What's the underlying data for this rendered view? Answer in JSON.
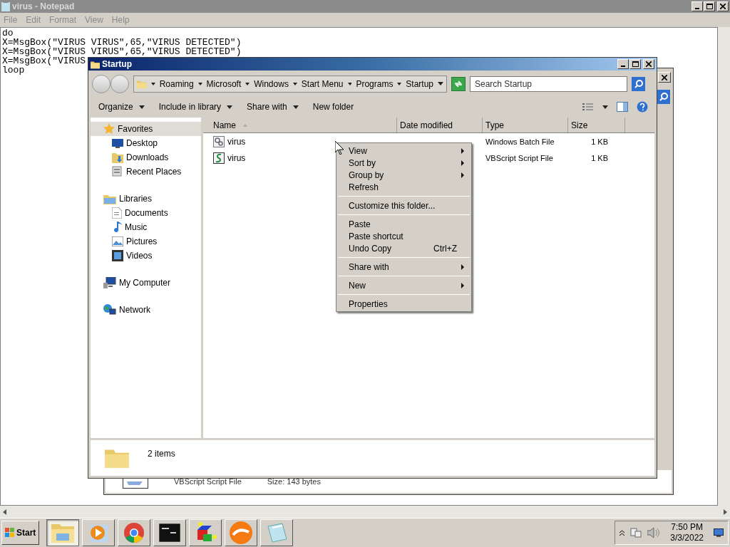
{
  "notepad": {
    "title": "virus - Notepad",
    "menu": [
      "File",
      "Edit",
      "Format",
      "View",
      "Help"
    ],
    "lines": [
      "do",
      "X=MsgBox(\"VIRUS VIRUS\",65,\"VIRUS DETECTED\")",
      "X=MsgBox(\"VIRUS VIRUS\",65,\"VIRUS DETECTED\")",
      "X=MsgBox(\"VIRUS",
      "loop"
    ]
  },
  "back_window": {
    "details": [
      "VBScript Script File",
      "Size: 143 bytes"
    ]
  },
  "explorer": {
    "title": "Startup",
    "breadcrumb": [
      "Roaming",
      "Microsoft",
      "Windows",
      "Start Menu",
      "Programs",
      "Startup"
    ],
    "search": {
      "placeholder": "Search Startup"
    },
    "toolbar": [
      {
        "label": "Organize",
        "dropdown": true
      },
      {
        "label": "Include in library",
        "dropdown": true
      },
      {
        "label": "Share with",
        "dropdown": true
      },
      {
        "label": "New folder",
        "dropdown": false
      }
    ],
    "nav": [
      {
        "label": "Favorites",
        "selected": true,
        "children": [
          {
            "label": "Desktop"
          },
          {
            "label": "Downloads"
          },
          {
            "label": "Recent Places"
          }
        ]
      },
      {
        "label": "Libraries",
        "selected": false,
        "children": [
          {
            "label": "Documents"
          },
          {
            "label": "Music"
          },
          {
            "label": "Pictures"
          },
          {
            "label": "Videos"
          }
        ]
      },
      {
        "label": "My Computer",
        "selected": false
      },
      {
        "label": "Network",
        "selected": false
      }
    ],
    "columns": [
      "Name",
      "Date modified",
      "Type",
      "Size"
    ],
    "files": [
      {
        "name": "virus",
        "kind": "batch",
        "type": "Windows Batch File",
        "size": "1 KB"
      },
      {
        "name": "virus",
        "kind": "script",
        "type": "VBScript Script File",
        "size": "1 KB"
      }
    ],
    "status": "2 items"
  },
  "context_menu": [
    {
      "kind": "item",
      "label": "View",
      "submenu": true
    },
    {
      "kind": "item",
      "label": "Sort by",
      "submenu": true
    },
    {
      "kind": "item",
      "label": "Group by",
      "submenu": true
    },
    {
      "kind": "item",
      "label": "Refresh",
      "submenu": false
    },
    {
      "kind": "separator"
    },
    {
      "kind": "item",
      "label": "Customize this folder...",
      "submenu": false
    },
    {
      "kind": "separator"
    },
    {
      "kind": "item",
      "label": "Paste",
      "submenu": false
    },
    {
      "kind": "item",
      "label": "Paste shortcut",
      "submenu": false
    },
    {
      "kind": "item",
      "label": "Undo Copy",
      "shortcut": "Ctrl+Z",
      "submenu": false
    },
    {
      "kind": "separator"
    },
    {
      "kind": "item",
      "label": "Share with",
      "submenu": true
    },
    {
      "kind": "separator"
    },
    {
      "kind": "item",
      "label": "New",
      "submenu": true
    },
    {
      "kind": "separator"
    },
    {
      "kind": "item",
      "label": "Properties",
      "submenu": false
    }
  ],
  "taskbar": {
    "start": "Start",
    "apps": [
      {
        "kind": "explorer",
        "selected": true
      },
      {
        "kind": "media",
        "selected": false
      },
      {
        "kind": "browser",
        "selected": false
      },
      {
        "kind": "terminal",
        "selected": false
      },
      {
        "kind": "cube",
        "selected": false
      },
      {
        "kind": "orange",
        "selected": false
      },
      {
        "kind": "notepad",
        "selected": false
      }
    ],
    "time": "7:50 PM",
    "date": "3/3/2022"
  }
}
